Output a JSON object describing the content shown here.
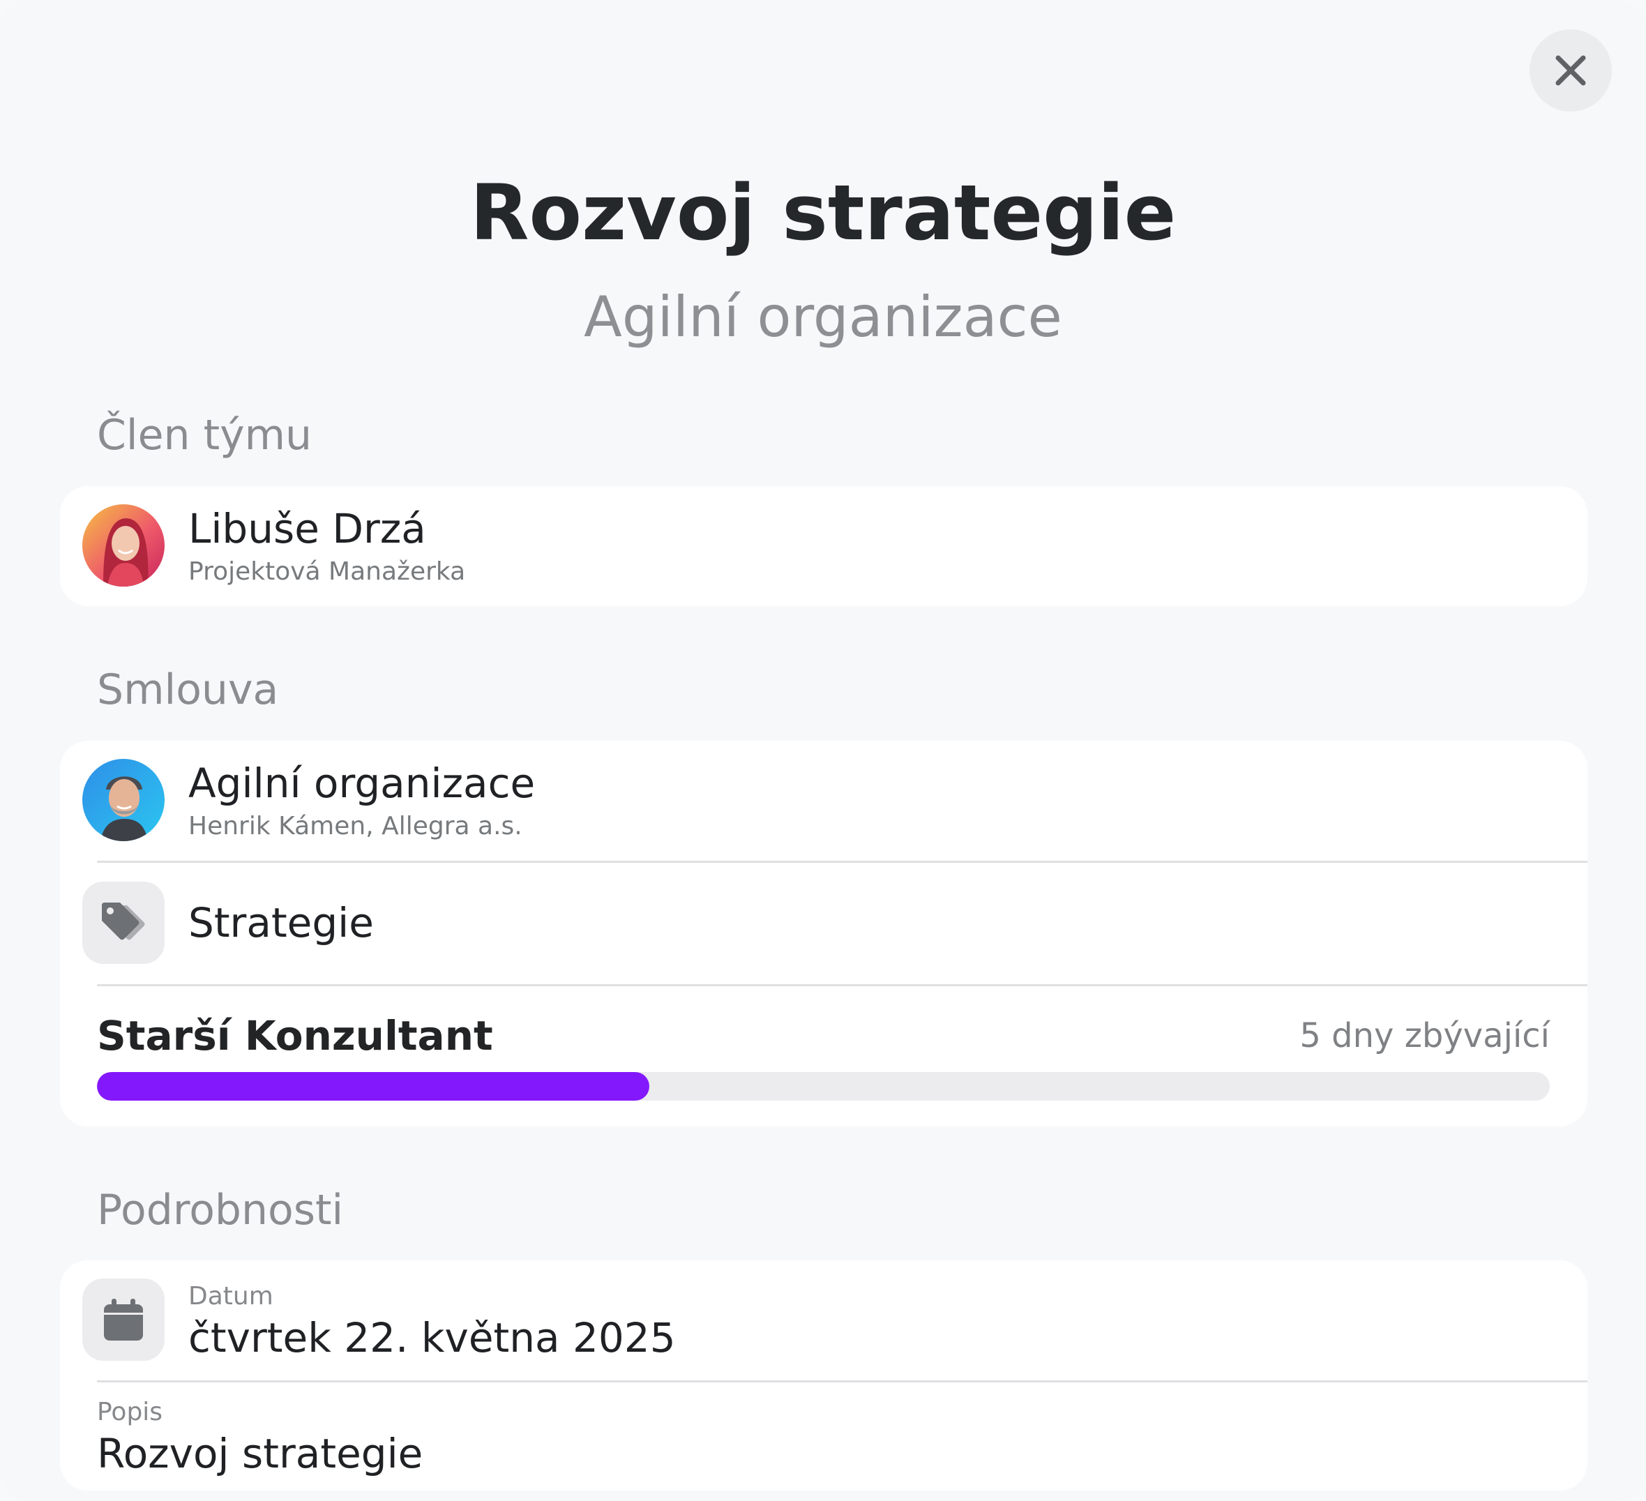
{
  "modal": {
    "title": "Rozvoj strategie",
    "subtitle": "Agilní organizace"
  },
  "team_member": {
    "section_label": "Člen týmu",
    "name": "Libuše Drzá",
    "role": "Projektová Manažerka"
  },
  "contract": {
    "section_label": "Smlouva",
    "name": "Agilní organizace",
    "client": "Henrik Kámen, Allegra a.s.",
    "tag": "Strategie",
    "position": "Starší Konzultant",
    "remaining": "5 dny zbývající",
    "progress_fraction": 0.38
  },
  "details": {
    "section_label": "Podrobnosti",
    "date_label": "Datum",
    "date_value": "čtvrtek 22. května 2025",
    "description_label": "Popis",
    "description_value": "Rozvoj strategie"
  },
  "colors": {
    "accent": "#8418fc",
    "background": "#f7f8fa",
    "card": "#ffffff"
  },
  "icons": {
    "close": "close-icon",
    "tag": "tag-icon",
    "calendar": "calendar-icon"
  }
}
